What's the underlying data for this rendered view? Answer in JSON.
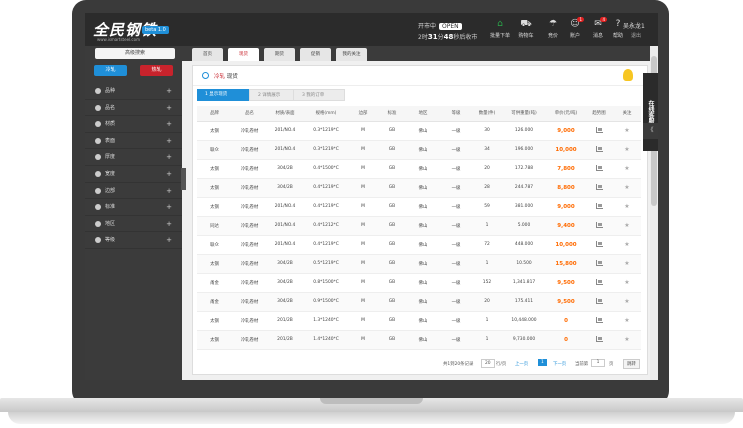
{
  "header": {
    "logo_text": "全民钢铁",
    "logo_url_text": "www.ismartsteel.com",
    "beta_label": "beta 1.0",
    "market_label": "开市中",
    "market_tag": "OPEN",
    "countdown_prefix": "2时",
    "countdown_minutes": "31",
    "countdown_mid": "分",
    "countdown_seconds": "48",
    "countdown_suffix": "秒后收市",
    "icons": [
      {
        "label": "批量下单",
        "icon": "shop-icon",
        "color": "#2aa84a",
        "badge": ""
      },
      {
        "label": "购物车",
        "icon": "cart-icon",
        "color": "#dddddd",
        "badge": ""
      },
      {
        "label": "竞价",
        "icon": "auction-icon",
        "color": "#dddddd",
        "badge": ""
      },
      {
        "label": "账户",
        "icon": "account-icon",
        "color": "#dddddd",
        "badge": "1"
      },
      {
        "label": "消息",
        "icon": "message-icon",
        "color": "#dddddd",
        "badge": "4"
      },
      {
        "label": "帮助",
        "icon": "help-icon",
        "color": "#dddddd",
        "badge": ""
      }
    ],
    "user_name": "吴永龙1",
    "logout_label": "退出"
  },
  "sidebar": {
    "search_label": "高级搜索",
    "cold_label": "冷轧",
    "hot_label": "热轧",
    "items": [
      {
        "label": "品种",
        "icon": "variety-icon"
      },
      {
        "label": "品名",
        "icon": "name-icon"
      },
      {
        "label": "材质",
        "icon": "material-icon"
      },
      {
        "label": "表面",
        "icon": "surface-icon"
      },
      {
        "label": "厚度",
        "icon": "thickness-icon"
      },
      {
        "label": "宽度",
        "icon": "width-icon"
      },
      {
        "label": "边部",
        "icon": "edge-icon"
      },
      {
        "label": "标准",
        "icon": "standard-icon"
      },
      {
        "label": "地区",
        "icon": "region-icon"
      },
      {
        "label": "等级",
        "icon": "grade-icon"
      }
    ]
  },
  "tabs": [
    {
      "label": "首页",
      "active": false
    },
    {
      "label": "现货",
      "active": true
    },
    {
      "label": "期货",
      "active": false
    },
    {
      "label": "促销",
      "active": false
    },
    {
      "label": "我的关注",
      "active": false
    }
  ],
  "main": {
    "crumb_red": "冷轧",
    "crumb_rest": "现货",
    "steps": [
      "1 显示现货",
      "2 详情展示",
      "3 我的订单"
    ],
    "columns": [
      "品牌",
      "品名",
      "材质/表面",
      "规格(mm)",
      "边部",
      "标准",
      "地区",
      "等级",
      "数量(件)",
      "可供重量(吨)",
      "单价(元/吨)",
      "趋势图",
      "关注"
    ],
    "rows": [
      [
        "太钢",
        "冷轧卷材",
        "201/NO.4",
        "0.3*1219*C",
        "M",
        "GB",
        "佛山",
        "一级",
        "30",
        "126.000",
        "9,000"
      ],
      [
        "联众",
        "冷轧卷材",
        "201/NO.4",
        "0.3*1219*C",
        "M",
        "GB",
        "佛山",
        "一级",
        "34",
        "196.000",
        "10,000"
      ],
      [
        "太钢",
        "冷轧卷材",
        "304/2B",
        "0.4*1500*C",
        "M",
        "GB",
        "佛山",
        "一级",
        "20",
        "172.788",
        "7,800"
      ],
      [
        "太钢",
        "冷轧卷材",
        "304/2B",
        "0.4*1219*C",
        "M",
        "GB",
        "佛山",
        "一级",
        "28",
        "244.787",
        "8,800"
      ],
      [
        "太钢",
        "冷轧卷材",
        "201/NO.4",
        "0.4*1219*C",
        "M",
        "GB",
        "佛山",
        "一级",
        "59",
        "381.000",
        "9,000"
      ],
      [
        "同达",
        "冷轧卷材",
        "201/NO.4",
        "0.4*1212*C",
        "M",
        "GB",
        "佛山",
        "一级",
        "1",
        "5.000",
        "9,400"
      ],
      [
        "联众",
        "冷轧卷材",
        "201/NO.4",
        "0.4*1219*C",
        "M",
        "GB",
        "佛山",
        "一级",
        "72",
        "448.000",
        "10,000"
      ],
      [
        "太钢",
        "冷轧卷材",
        "304/2B",
        "0.5*1219*C",
        "M",
        "GB",
        "佛山",
        "一级",
        "1",
        "10.500",
        "15,800"
      ],
      [
        "甬金",
        "冷轧卷材",
        "304/2B",
        "0.8*1500*C",
        "M",
        "GB",
        "佛山",
        "一级",
        "152",
        "1,341.817",
        "9,500"
      ],
      [
        "甬金",
        "冷轧卷材",
        "304/2B",
        "0.9*1500*C",
        "M",
        "GB",
        "佛山",
        "一级",
        "20",
        "175.411",
        "9,500"
      ],
      [
        "太钢",
        "冷轧卷材",
        "201/2B",
        "1.3*1240*C",
        "M",
        "GB",
        "佛山",
        "一级",
        "1",
        "10,448.000",
        "0"
      ],
      [
        "太钢",
        "冷轧卷材",
        "201/2B",
        "1.4*1240*C",
        "M",
        "GB",
        "佛山",
        "一级",
        "1",
        "9,730.000",
        "0"
      ]
    ]
  },
  "pager": {
    "total": "共1到20条记录",
    "page_size": "20",
    "first": "行/页",
    "prev": "上一页",
    "current": "1",
    "next": "下一页",
    "goto_label": "当前第",
    "goto_value": "1",
    "page_unit": "页",
    "go_label": "跳转"
  },
  "side_service": "在线客服",
  "side_collapse": "《"
}
